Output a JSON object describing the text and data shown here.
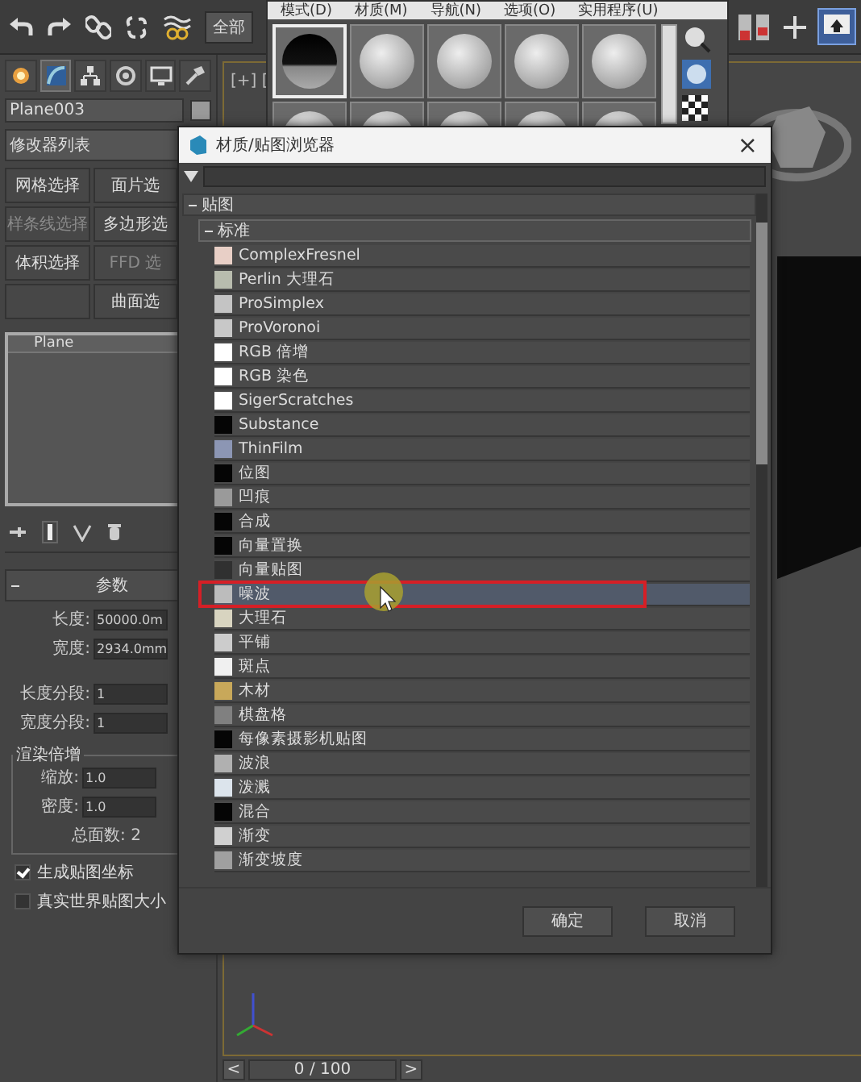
{
  "toolbar": {
    "selection_filter": "全部"
  },
  "material_editor": {
    "menu": [
      "模式(D)",
      "材质(M)",
      "导航(N)",
      "选项(O)",
      "实用程序(U)"
    ],
    "sample_slots": [
      {
        "kind": "chrome",
        "selected": true
      },
      {
        "kind": "matte",
        "selected": false
      },
      {
        "kind": "matte",
        "selected": false
      },
      {
        "kind": "matte",
        "selected": false
      },
      {
        "kind": "matte",
        "selected": false
      },
      {
        "kind": "matte",
        "selected": false
      },
      {
        "kind": "matte",
        "selected": false
      },
      {
        "kind": "matte",
        "selected": false
      },
      {
        "kind": "matte",
        "selected": false
      },
      {
        "kind": "matte",
        "selected": false
      }
    ]
  },
  "command_panel": {
    "tabs": [
      {
        "kind": "create",
        "selected": false
      },
      {
        "kind": "modify",
        "selected": true
      },
      {
        "kind": "hierarchy",
        "selected": false
      },
      {
        "kind": "motion",
        "selected": false
      },
      {
        "kind": "display",
        "selected": false
      },
      {
        "kind": "utilities",
        "selected": false
      }
    ],
    "object_name": "Plane003",
    "modifier_list": "修改器列表",
    "modifier_buttons": [
      {
        "label": "网格选择",
        "disabled": false
      },
      {
        "label": "面片选",
        "disabled": false
      },
      {
        "label": "样条线选择",
        "disabled": true
      },
      {
        "label": "多边形选",
        "disabled": false
      },
      {
        "label": "体积选择",
        "disabled": false
      },
      {
        "label": "FFD 选",
        "disabled": true
      },
      {
        "label": "曲面选",
        "disabled": false
      }
    ],
    "stack": [
      {
        "label": "Plane"
      }
    ],
    "rollout": {
      "title": "参数",
      "expanded": true,
      "fields": [
        {
          "label": "长度:",
          "value": "50000.0m"
        },
        {
          "label": "宽度:",
          "value": "2934.0mm"
        }
      ],
      "segments": [
        {
          "label": "长度分段:",
          "value": "1"
        },
        {
          "label": "宽度分段:",
          "value": "1"
        }
      ],
      "group": {
        "title": "渲染倍增",
        "fields": [
          {
            "label": "缩放:",
            "value": "1.0"
          },
          {
            "label": "密度:",
            "value": "1.0"
          }
        ],
        "total": "总面数: 2"
      },
      "checkboxes": [
        {
          "label": "生成贴图坐标",
          "checked": true
        },
        {
          "label": "真实世界贴图大小",
          "checked": false
        }
      ]
    }
  },
  "viewport": {
    "label": "[+] [",
    "timeline": {
      "prev": "<",
      "position": "0 / 100",
      "next": ">",
      "level": 0
    }
  },
  "dialog": {
    "title": "材质/贴图浏览器",
    "close": "×",
    "groups": [
      {
        "label": "贴图",
        "expanded": true,
        "children": [
          {
            "label": "标准",
            "expanded": true,
            "children": [
              {
                "label": "ComplexFresnel",
                "color": "#e8cfc6",
                "selected": false
              },
              {
                "label": "Perlin 大理石",
                "color": "#b8bcae",
                "selected": false
              },
              {
                "label": "ProSimplex",
                "color": "#c4c4c4",
                "selected": false
              },
              {
                "label": "ProVoronoi",
                "color": "#c8c8c8",
                "selected": false
              },
              {
                "label": "RGB 倍增",
                "color": "#ffffff",
                "selected": false
              },
              {
                "label": "RGB 染色",
                "color": "#ffffff",
                "selected": false
              },
              {
                "label": "SigerScratches",
                "color": "#ffffff",
                "selected": false
              },
              {
                "label": "Substance",
                "color": "#050505",
                "selected": false
              },
              {
                "label": "ThinFilm",
                "color": "#8c96b4",
                "selected": false
              },
              {
                "label": "位图",
                "color": "#050505",
                "selected": false
              },
              {
                "label": "凹痕",
                "color": "#9a9a9a",
                "selected": false
              },
              {
                "label": "合成",
                "color": "#050505",
                "selected": false
              },
              {
                "label": "向量置换",
                "color": "#050505",
                "selected": false
              },
              {
                "label": "向量贴图",
                "color": "#303030",
                "selected": false
              },
              {
                "label": "噪波",
                "color": "#bcbcbc",
                "selected": true
              },
              {
                "label": "大理石",
                "color": "#d8d4c0",
                "selected": false
              },
              {
                "label": "平铺",
                "color": "#cccccc",
                "selected": false
              },
              {
                "label": "斑点",
                "color": "#f0f0f0",
                "selected": false
              },
              {
                "label": "木材",
                "color": "#c8a85a",
                "selected": false
              },
              {
                "label": "棋盘格",
                "color": "#808080",
                "selected": false
              },
              {
                "label": "每像素摄影机贴图",
                "color": "#050505",
                "selected": false
              },
              {
                "label": "波浪",
                "color": "#b0b0b0",
                "selected": false
              },
              {
                "label": "泼溅",
                "color": "#dce4ec",
                "selected": false
              },
              {
                "label": "混合",
                "color": "#050505",
                "selected": false
              },
              {
                "label": "渐变",
                "color": "#d0d0d0",
                "selected": false
              },
              {
                "label": "渐变坡度",
                "color": "#a0a0a0",
                "selected": false
              }
            ]
          }
        ]
      }
    ],
    "buttons": [
      "确定",
      "取消"
    ]
  }
}
